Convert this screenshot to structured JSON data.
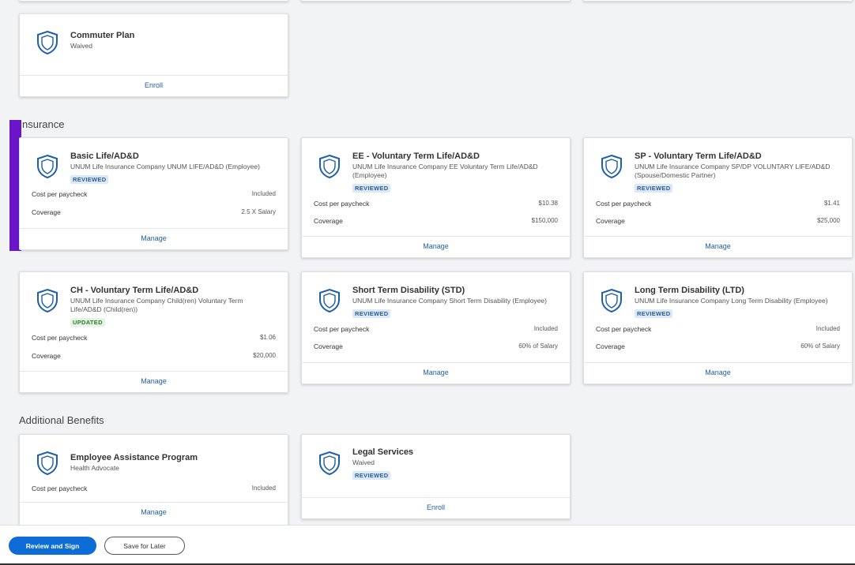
{
  "colors": {
    "accent": "#0e6cd6",
    "link": "#1f5fa8",
    "reviewed_badge": "#dbe8f7",
    "updated_badge": "#e6f4e6",
    "highlight_bar": "#6a16c8"
  },
  "sections": {
    "insurance": "nsurance",
    "additional": "Additional Benefits"
  },
  "commuter": {
    "title": "Commuter Plan",
    "sub": "Waived",
    "action": "Enroll"
  },
  "insurance_cards": [
    {
      "title": "Basic Life/AD&D",
      "sub": "UNUM Life Insurance Company UNUM LIFE/AD&D (Employee)",
      "badge": "REVIEWED",
      "cost_label": "Cost per paycheck",
      "cost": "Included",
      "cov_label": "Coverage",
      "cov": "2.5 X Salary",
      "action": "Manage"
    },
    {
      "title": "EE - Voluntary Term Life/AD&D",
      "sub": "UNUM Life Insurance Company EE Voluntary Term Life/AD&D (Employee)",
      "badge": "REVIEWED",
      "cost_label": "Cost per paycheck",
      "cost": "$10.38",
      "cov_label": "Coverage",
      "cov": "$150,000",
      "action": "Manage"
    },
    {
      "title": "SP - Voluntary Term Life/AD&D",
      "sub": "UNUM Life Insurance Company SP/DP VOLUNTARY LIFE/AD&D (Spouse/Domestic Partner)",
      "badge": "REVIEWED",
      "cost_label": "Cost per paycheck",
      "cost": "$1.41",
      "cov_label": "Coverage",
      "cov": "$25,000",
      "action": "Manage"
    },
    {
      "title": "CH - Voluntary Term Life/AD&D",
      "sub": "UNUM Life Insurance Company Child(ren) Voluntary Term Life/AD&D (Child(ren))",
      "badge": "UPDATED",
      "cost_label": "Cost per paycheck",
      "cost": "$1.06",
      "cov_label": "Coverage",
      "cov": "$20,000",
      "action": "Manage"
    },
    {
      "title": "Short Term Disability (STD)",
      "sub": "UNUM Life Insurance Company Short Term Disability (Employee)",
      "badge": "REVIEWED",
      "cost_label": "Cost per paycheck",
      "cost": "Included",
      "cov_label": "Coverage",
      "cov": "60% of Salary",
      "action": "Manage"
    },
    {
      "title": "Long Term Disability (LTD)",
      "sub": "UNUM Life Insurance Company Long Term Disability (Employee)",
      "badge": "REVIEWED",
      "cost_label": "Cost per paycheck",
      "cost": "Included",
      "cov_label": "Coverage",
      "cov": "60% of Salary",
      "action": "Manage"
    }
  ],
  "additional_cards": [
    {
      "title": "Employee Assistance Program",
      "sub": "Health Advocate",
      "cost_label": "Cost per paycheck",
      "cost": "Included",
      "action": "Manage"
    },
    {
      "title": "Legal Services",
      "sub": "Waived",
      "badge": "REVIEWED",
      "action": "Enroll"
    }
  ],
  "footer": {
    "primary": "Review and Sign",
    "secondary": "Save for Later"
  }
}
